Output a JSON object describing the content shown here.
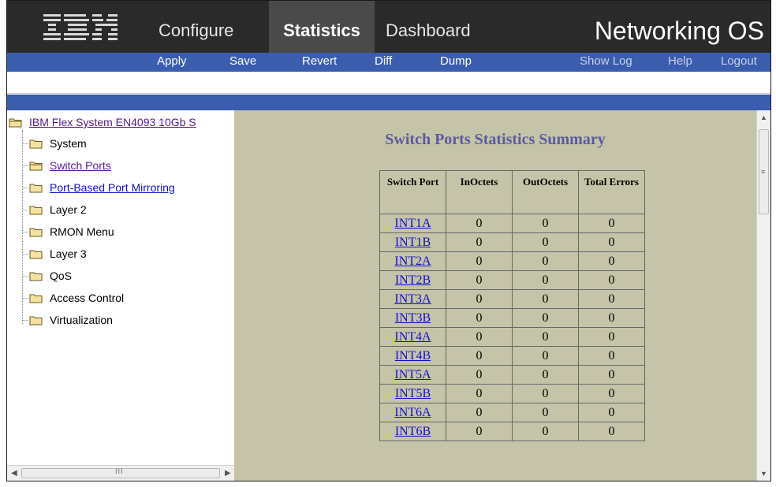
{
  "header": {
    "logo_text": "IBM",
    "tabs": [
      "Configure",
      "Statistics",
      "Dashboard"
    ],
    "active_tab": "Statistics",
    "brand": "Networking OS"
  },
  "actions": {
    "apply": "Apply",
    "save": "Save",
    "revert": "Revert",
    "diff": "Diff",
    "dump": "Dump",
    "show_log": "Show Log",
    "help": "Help",
    "logout": "Logout"
  },
  "nav": {
    "root": "IBM Flex System EN4093 10Gb S",
    "items": [
      {
        "label": "System",
        "link": false
      },
      {
        "label": "Switch Ports",
        "link": true,
        "open": true
      },
      {
        "label": "Port-Based Port Mirroring",
        "link": true
      },
      {
        "label": "Layer 2",
        "link": false
      },
      {
        "label": "RMON Menu",
        "link": false
      },
      {
        "label": "Layer 3",
        "link": false
      },
      {
        "label": "QoS",
        "link": false
      },
      {
        "label": "Access Control",
        "link": false
      },
      {
        "label": "Virtualization",
        "link": false
      }
    ],
    "hscroll_grip": "III"
  },
  "main": {
    "title": "Switch Ports Statistics Summary",
    "columns": [
      "Switch Port",
      "InOctets",
      "OutOctets",
      "Total Errors"
    ],
    "rows": [
      [
        "INT1A",
        "0",
        "0",
        "0"
      ],
      [
        "INT1B",
        "0",
        "0",
        "0"
      ],
      [
        "INT2A",
        "0",
        "0",
        "0"
      ],
      [
        "INT2B",
        "0",
        "0",
        "0"
      ],
      [
        "INT3A",
        "0",
        "0",
        "0"
      ],
      [
        "INT3B",
        "0",
        "0",
        "0"
      ],
      [
        "INT4A",
        "0",
        "0",
        "0"
      ],
      [
        "INT4B",
        "0",
        "0",
        "0"
      ],
      [
        "INT5A",
        "0",
        "0",
        "0"
      ],
      [
        "INT5B",
        "0",
        "0",
        "0"
      ],
      [
        "INT6A",
        "0",
        "0",
        "0"
      ],
      [
        "INT6B",
        "0",
        "0",
        "0"
      ]
    ]
  },
  "colors": {
    "topbar": "#2a2a2a",
    "actionbar": "#3a5dae",
    "content_bg": "#c6c4a8",
    "title": "#5a5aa0",
    "link": "#1010cc"
  }
}
